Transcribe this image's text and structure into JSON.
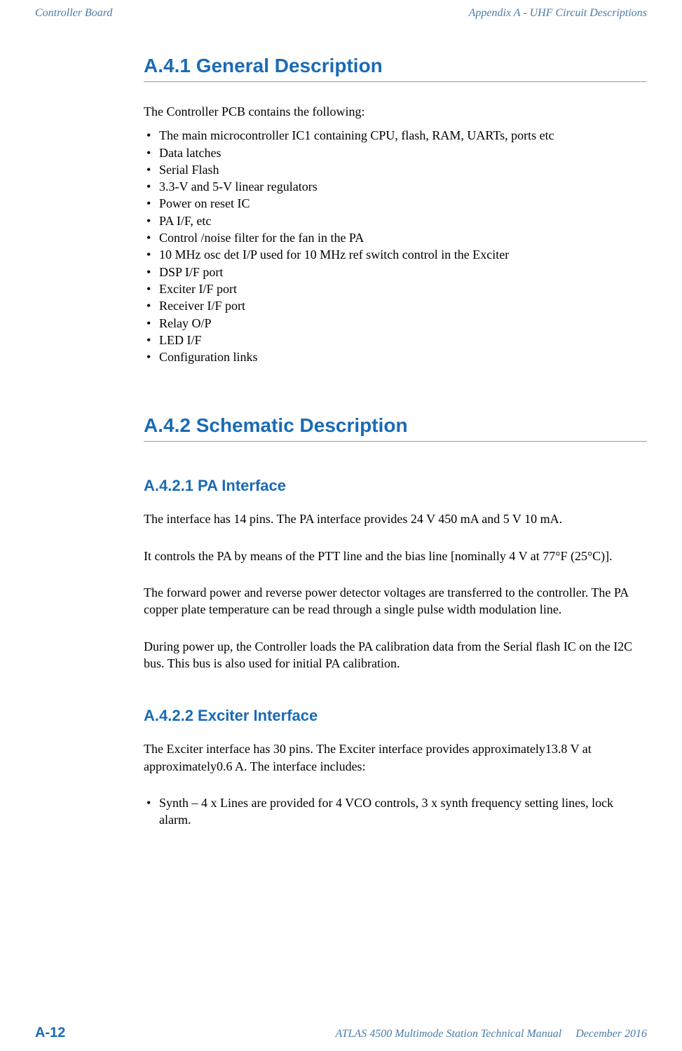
{
  "header": {
    "left": "Controller Board",
    "right": "Appendix A - UHF Circuit Descriptions"
  },
  "sections": {
    "s1": {
      "title": "A.4.1    General Description",
      "intro": "The Controller PCB contains the following:",
      "bullets": [
        "The main microcontroller IC1 containing CPU, flash, RAM, UARTs, ports etc",
        "Data latches",
        "Serial Flash",
        "3.3-V and 5-V linear regulators",
        "Power on reset IC",
        "PA I/F, etc",
        "Control /noise filter for the fan in the PA",
        "10 MHz osc det I/P used for 10 MHz ref switch control in the Exciter",
        "DSP I/F port",
        "Exciter I/F port",
        "Receiver I/F port",
        "Relay O/P",
        "LED I/F",
        "Configuration links"
      ]
    },
    "s2": {
      "title": "A.4.2    Schematic Description"
    },
    "s21": {
      "title": "A.4.2.1   PA Interface",
      "p1": "The interface has 14 pins. The PA interface provides 24 V 450 mA and 5 V 10 mA.",
      "p2": "It controls the PA by means of the PTT line and the bias line [nominally 4 V at 77°F (25°C)].",
      "p3": "The forward power and reverse power detector voltages are transferred to the controller. The PA copper plate temperature can be read through a single pulse width modulation line.",
      "p4": "During power up, the Controller loads the PA calibration data from the Serial flash IC on the I2C bus. This bus is also used for initial PA calibration."
    },
    "s22": {
      "title": "A.4.2.2   Exciter Interface",
      "p1": "The Exciter interface has 30 pins. The Exciter interface provides approximately13.8 V at approximately0.6 A. The interface includes:",
      "bullets": [
        "Synth – 4 x Lines are provided for 4 VCO controls, 3 x synth frequency setting lines, lock alarm."
      ]
    }
  },
  "footer": {
    "page": "A-12",
    "manual": "ATLAS 4500 Multimode Station Technical Manual",
    "date": "December 2016"
  }
}
